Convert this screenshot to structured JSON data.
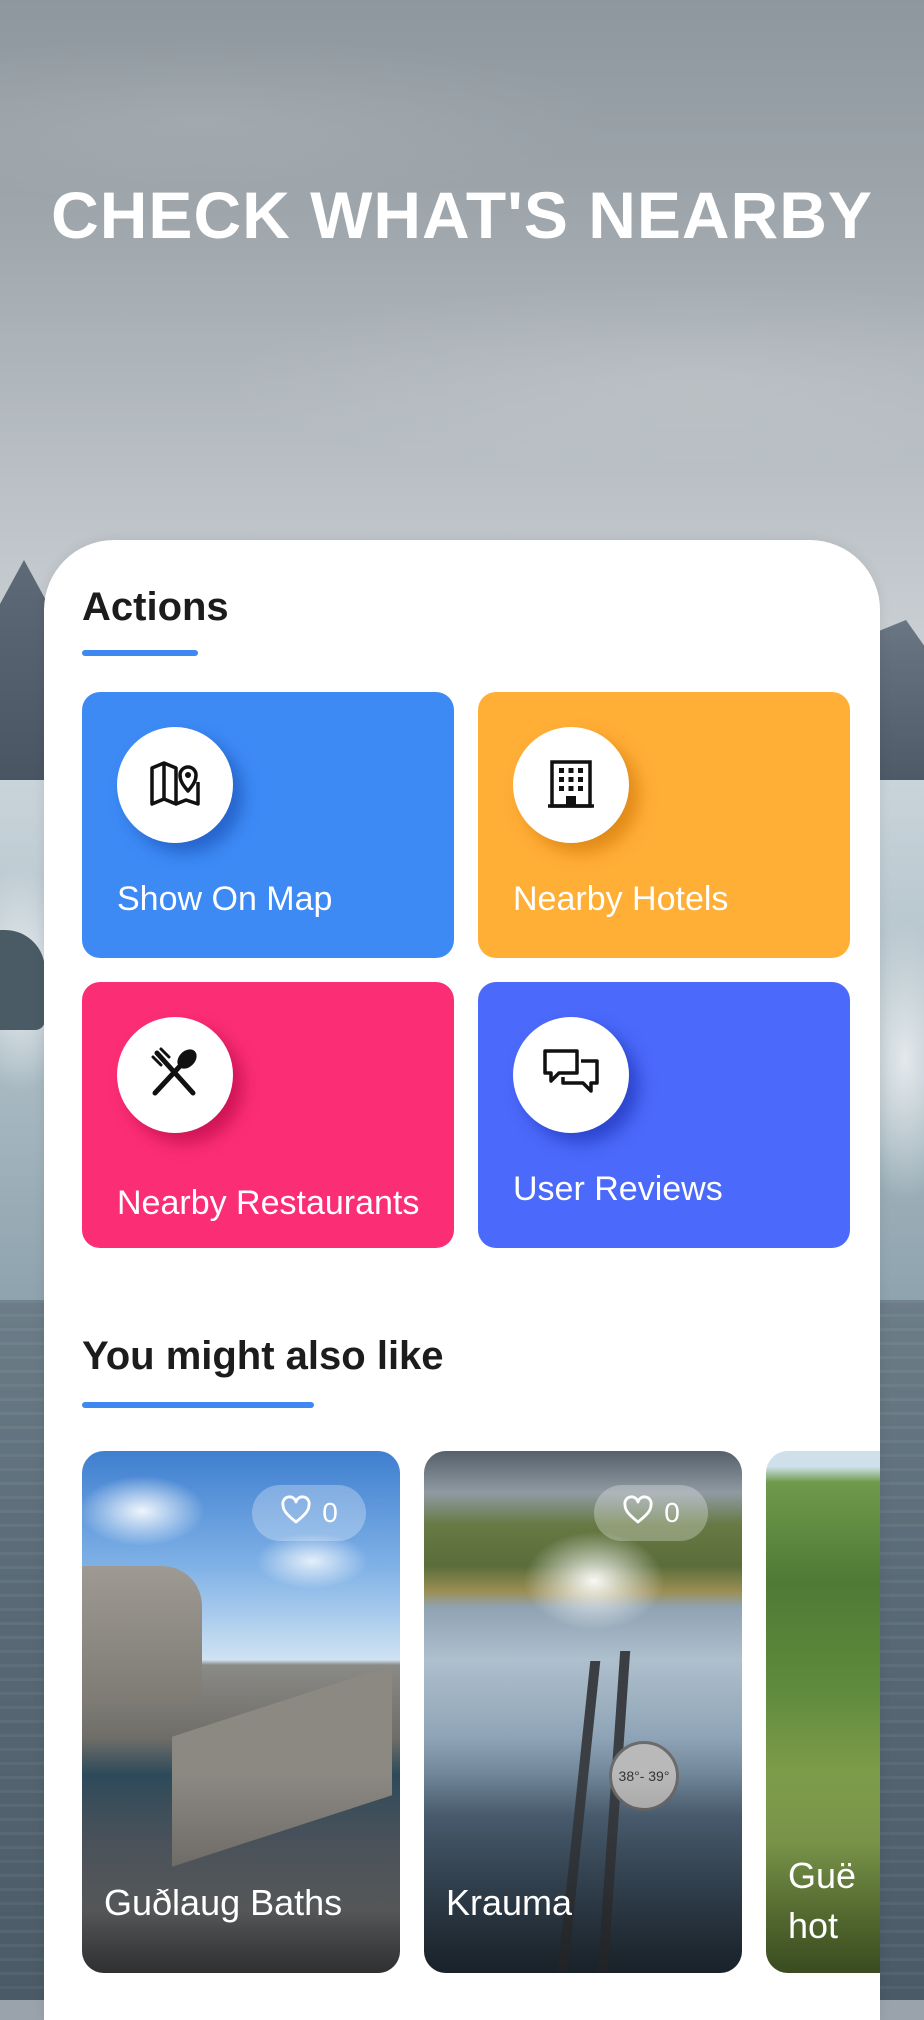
{
  "header": {
    "headline": "CHECK WHAT'S NEARBY"
  },
  "actions": {
    "title": "Actions",
    "tiles": [
      {
        "label": "Show On Map",
        "icon": "map-pin-icon",
        "color": "#3d8af5"
      },
      {
        "label": "Nearby Hotels",
        "icon": "hotel-building-icon",
        "color": "#ffae36"
      },
      {
        "label": "Nearby Restaurants",
        "icon": "fork-spoon-icon",
        "color": "#fb2d75"
      },
      {
        "label": "User Reviews",
        "icon": "chat-bubbles-icon",
        "color": "#4b69fa"
      }
    ]
  },
  "suggestions": {
    "title": "You might also like",
    "items": [
      {
        "name": "Guðlaug Baths",
        "likes": "0"
      },
      {
        "name": "Krauma",
        "likes": "0",
        "sign": "38°- 39°"
      },
      {
        "name": "Guë hot"
      }
    ]
  },
  "colors": {
    "accent": "#3f87f1"
  }
}
